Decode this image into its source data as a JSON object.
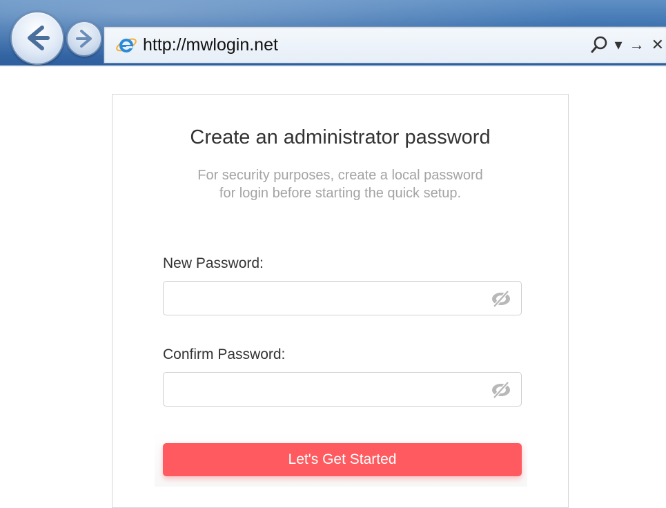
{
  "browser": {
    "url": "http://mwlogin.net",
    "icons": [
      "back-arrow-icon",
      "forward-arrow-icon",
      "ie-logo-icon",
      "search-icon",
      "dropdown-arrow-icon",
      "go-arrow-icon",
      "close-icon"
    ],
    "tools": {
      "dropdown": "▾",
      "go": "→",
      "close": "✕"
    }
  },
  "dialog": {
    "title": "Create an administrator password",
    "subtitle_line1": "For security purposes, create a local password",
    "subtitle_line2": "for login before starting the quick setup.",
    "new_password": {
      "label": "New Password:",
      "value": "",
      "placeholder": ""
    },
    "confirm_password": {
      "label": "Confirm Password:",
      "value": "",
      "placeholder": ""
    },
    "submit_label": "Let's Get Started"
  },
  "colors": {
    "accent": "#ff5a5f",
    "chrome_blue": "#3f74b1",
    "title_text": "#333333",
    "muted_text": "#a4a4a4"
  }
}
